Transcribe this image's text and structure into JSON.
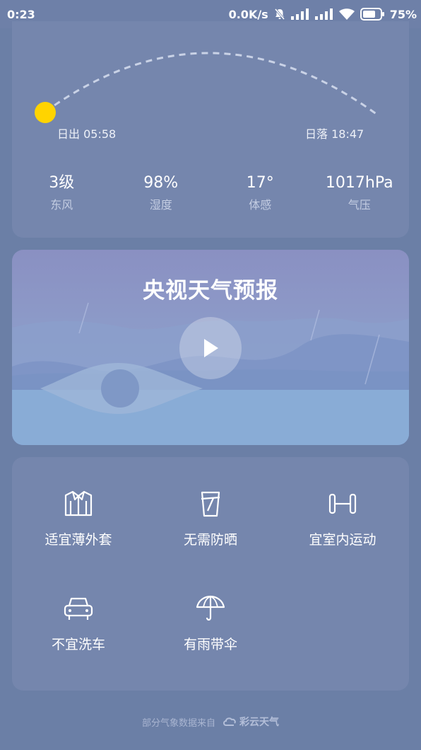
{
  "status_bar": {
    "time": "0:23",
    "net_speed": "0.0K/s",
    "battery_percent": "75%",
    "battery_level": 0.75,
    "icons": [
      "mute-bell-icon",
      "signal-icon",
      "signal-icon",
      "wifi-icon",
      "battery-icon"
    ]
  },
  "sun": {
    "sunrise_label": "日出 05:58",
    "sunset_label": "日落 18:47",
    "sun_color": "#ffd400"
  },
  "stats": [
    {
      "value": "3级",
      "label": "东风"
    },
    {
      "value": "98%",
      "label": "湿度"
    },
    {
      "value": "17°",
      "label": "体感"
    },
    {
      "value": "1017hPa",
      "label": "气压"
    }
  ],
  "video": {
    "title": "央视天气预报",
    "play_icon": "play-icon"
  },
  "tips": [
    {
      "label": "适宜薄外套",
      "icon": "jacket-icon"
    },
    {
      "label": "无需防晒",
      "icon": "sunscreen-cup-icon"
    },
    {
      "label": "宜室内运动",
      "icon": "dumbbell-icon"
    },
    {
      "label": "不宜洗车",
      "icon": "car-icon"
    },
    {
      "label": "有雨带伞",
      "icon": "umbrella-icon"
    }
  ],
  "footer": {
    "source_text": "部分气象数据来自",
    "brand": "彩云天气",
    "brand_icon": "cloud-icon"
  },
  "colors": {
    "background": "#6b7fa6",
    "card": "#7586ad"
  }
}
